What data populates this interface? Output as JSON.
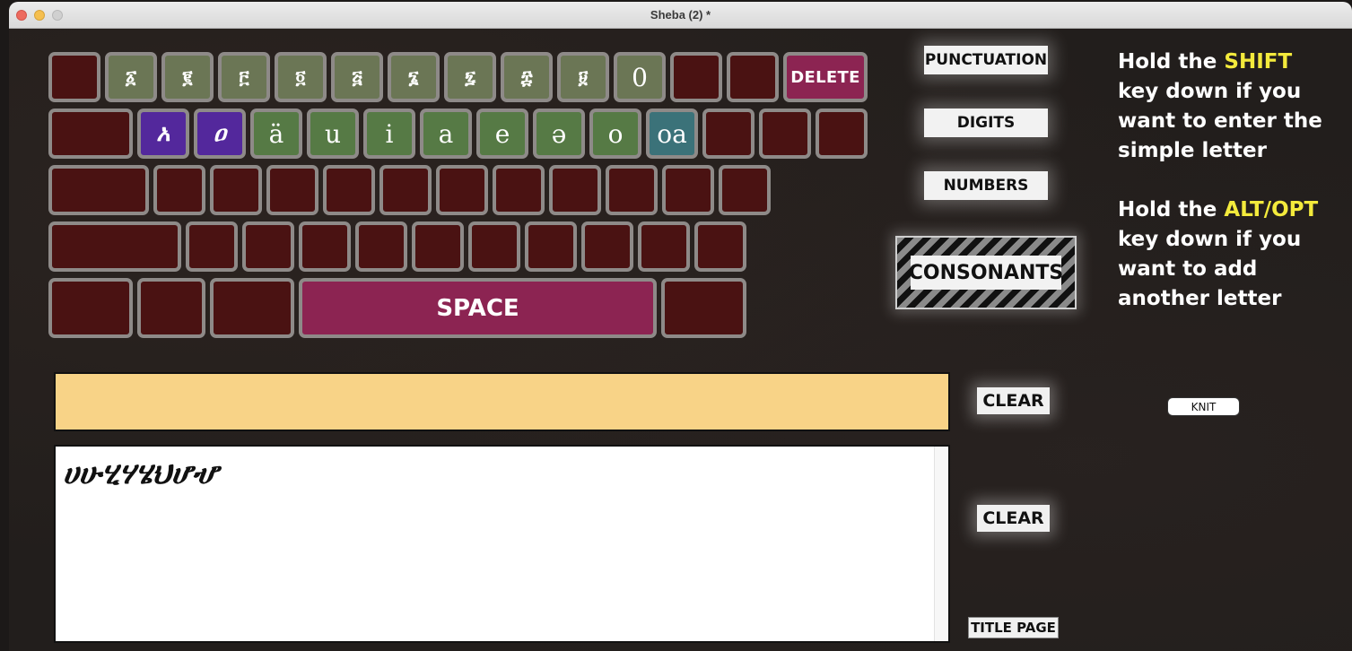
{
  "window": {
    "title": "Sheba (2) *"
  },
  "keyboard": {
    "row1": [
      {
        "label": "",
        "color": "dark"
      },
      {
        "label": "፩",
        "color": "olive"
      },
      {
        "label": "፪",
        "color": "olive"
      },
      {
        "label": "፫",
        "color": "olive"
      },
      {
        "label": "፬",
        "color": "olive"
      },
      {
        "label": "፭",
        "color": "olive"
      },
      {
        "label": "፮",
        "color": "olive"
      },
      {
        "label": "፯",
        "color": "olive"
      },
      {
        "label": "፰",
        "color": "olive"
      },
      {
        "label": "፱",
        "color": "olive"
      },
      {
        "label": "0",
        "color": "olive"
      },
      {
        "label": "",
        "color": "dark"
      },
      {
        "label": "",
        "color": "dark"
      },
      {
        "label": "DELETE",
        "color": "magenta"
      }
    ],
    "row2": [
      {
        "label": "",
        "color": "dark"
      },
      {
        "label": "አ",
        "color": "purple"
      },
      {
        "label": "ዐ",
        "color": "purple"
      },
      {
        "label": "ä",
        "color": "green"
      },
      {
        "label": "u",
        "color": "green"
      },
      {
        "label": "i",
        "color": "green"
      },
      {
        "label": "a",
        "color": "green"
      },
      {
        "label": "e",
        "color": "green"
      },
      {
        "label": "ə",
        "color": "green"
      },
      {
        "label": "o",
        "color": "green"
      },
      {
        "label": "oa",
        "color": "teal"
      },
      {
        "label": "",
        "color": "dark"
      },
      {
        "label": "",
        "color": "dark"
      },
      {
        "label": "",
        "color": "dark"
      }
    ],
    "space_label": "SPACE"
  },
  "modes": {
    "punctuation": "PUNCTUATION",
    "digits": "DIGITS",
    "numbers": "NUMBERS",
    "consonants": "CONSONANTS",
    "active": "CONSONANTS"
  },
  "instructions": {
    "shift": {
      "pre": "Hold the ",
      "key": "SHIFT",
      "rest": "key down if you want to enter the simple letter"
    },
    "alt": {
      "pre": "Hold the ",
      "key": "ALT/OPT",
      "rest": "key down if you want to add another letter"
    },
    "highlight_color": "#f3ea3c"
  },
  "input_field": {
    "value": ""
  },
  "output_area": {
    "value": "ሀሁሂሃሄህሆሇ"
  },
  "buttons": {
    "clear_input": "CLEAR",
    "clear_output": "CLEAR",
    "title_page": "TITLE PAGE",
    "knit": "KNIT"
  },
  "colors": {
    "key_dark": "#4a1212",
    "key_olive": "#6b7655",
    "key_green": "#567a45",
    "key_purple": "#53289c",
    "key_teal": "#3b7279",
    "key_magenta": "#8c2452",
    "input_bg": "#f8d387"
  }
}
